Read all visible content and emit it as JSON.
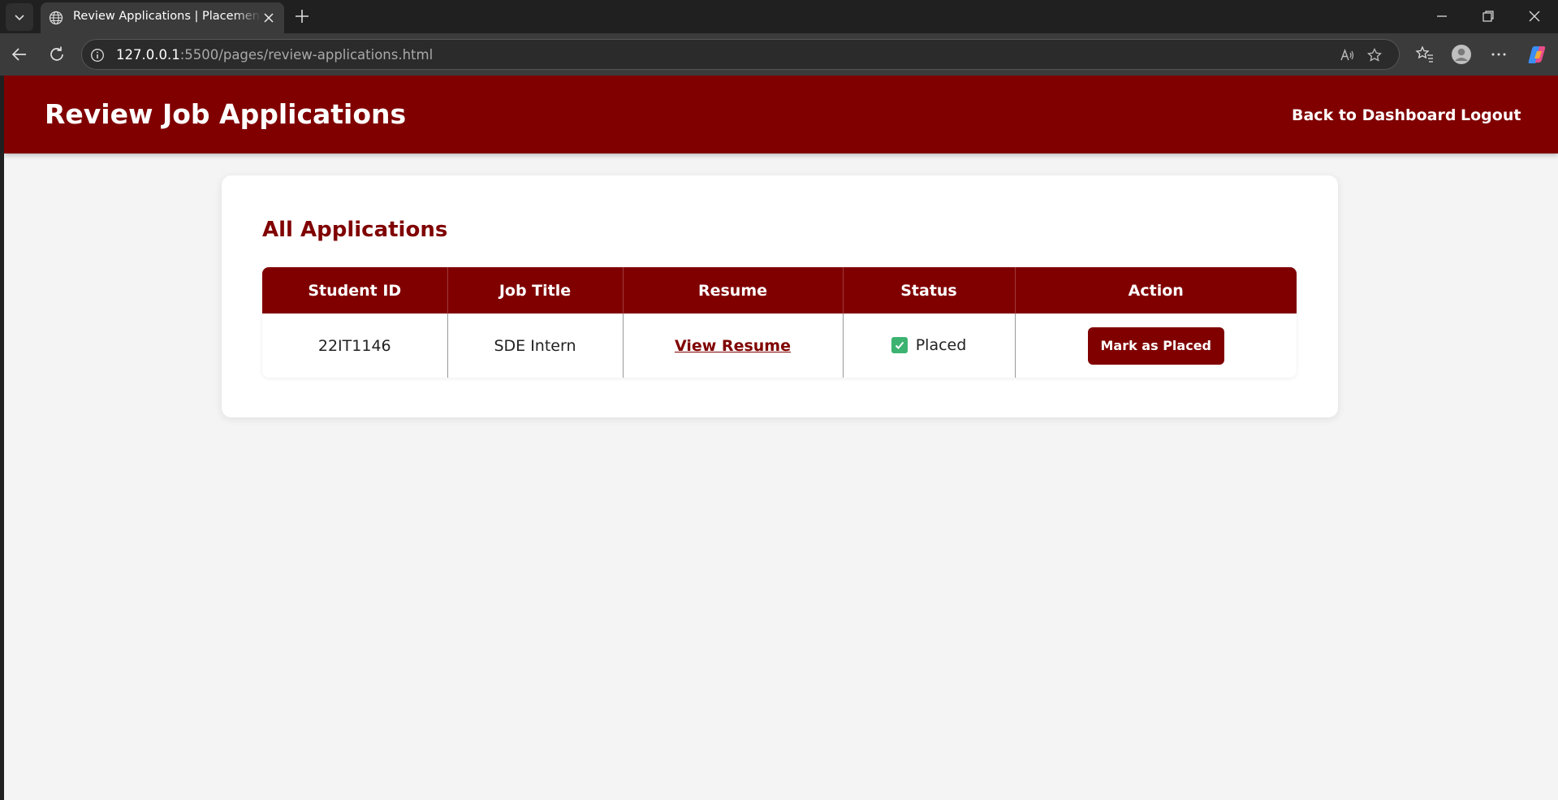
{
  "browser": {
    "tab_title": "Review Applications | PlacementPortal",
    "address_host": "127.0.0.1",
    "address_rest": ":5500/pages/review-applications.html"
  },
  "header": {
    "title": "Review Job Applications",
    "nav": {
      "dashboard": "Back to Dashboard",
      "logout": "Logout"
    }
  },
  "main": {
    "section_title": "All Applications",
    "table": {
      "columns": [
        "Student ID",
        "Job Title",
        "Resume",
        "Status",
        "Action"
      ],
      "rows": [
        {
          "student_id": "22IT1146",
          "job_title": "SDE Intern",
          "resume_link": "View Resume",
          "status": "Placed",
          "action": "Mark as Placed"
        }
      ]
    }
  },
  "colors": {
    "brand": "#800000",
    "status_placed": "#3cb371"
  }
}
